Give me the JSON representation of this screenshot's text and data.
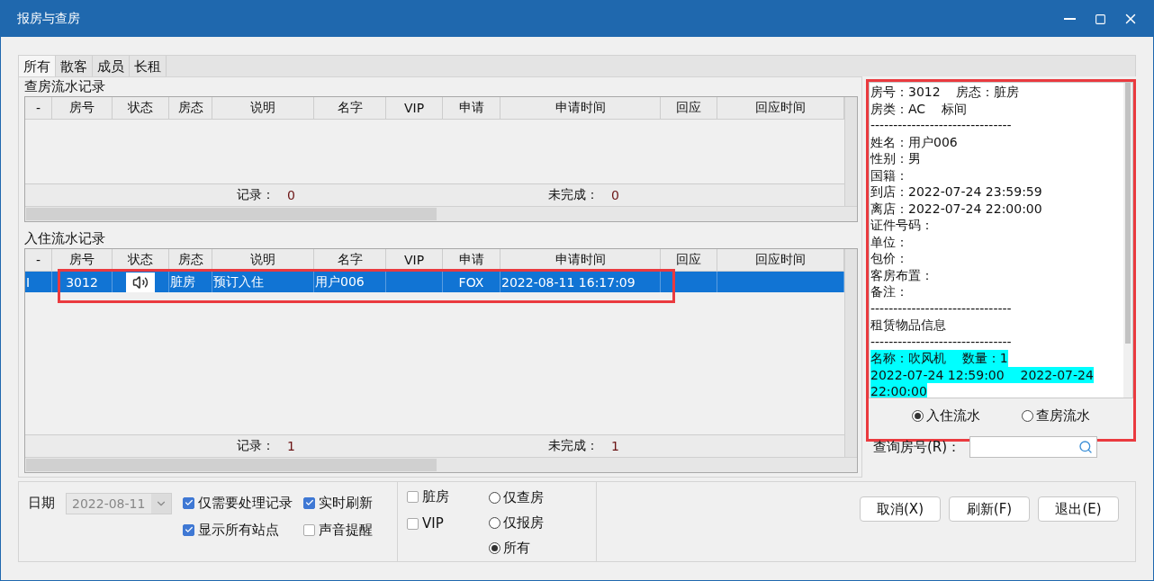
{
  "window": {
    "title": "报房与查房"
  },
  "tabs": [
    {
      "label": "所有",
      "selected": true
    },
    {
      "label": "散客",
      "selected": false
    },
    {
      "label": "成员",
      "selected": false
    },
    {
      "label": "长租",
      "selected": false
    }
  ],
  "check_log": {
    "title": "查房流水记录",
    "columns": [
      "-",
      "房号",
      "状态",
      "房态",
      "说明",
      "名字",
      "VIP",
      "申请",
      "申请时间",
      "回应",
      "回应时间"
    ],
    "records_label": "记录：",
    "records": "0",
    "pending_label": "未完成：",
    "pending": "0"
  },
  "checkin_log": {
    "title": "入住流水记录",
    "columns": [
      "-",
      "房号",
      "状态",
      "房态",
      "说明",
      "名字",
      "VIP",
      "申请",
      "申请时间",
      "回应",
      "回应时间"
    ],
    "rows": [
      {
        "selected": true,
        "marker": "I",
        "room_no": "3012",
        "room_state": "脏房",
        "note": "预订入住",
        "name": "用户006",
        "request": "FOX",
        "request_time": "2022-08-11 16:17:09"
      }
    ],
    "records_label": "记录：",
    "records": "1",
    "pending_label": "未完成：",
    "pending": "1"
  },
  "info_panel": {
    "lines": [
      {
        "text": "房号：3012    房态：脏房",
        "highlighted": false
      },
      {
        "text": "房类：AC    标间",
        "highlighted": false
      },
      {
        "text": "-------------------------------",
        "highlighted": false
      },
      {
        "text": "姓名：用户006",
        "highlighted": false
      },
      {
        "text": "性别：男",
        "highlighted": false
      },
      {
        "text": "国籍：",
        "highlighted": false
      },
      {
        "text": "到店：2022-07-24 23:59:59",
        "highlighted": false
      },
      {
        "text": "离店：2022-07-24 22:00:00",
        "highlighted": false
      },
      {
        "text": "证件号码：",
        "highlighted": false
      },
      {
        "text": "单位：",
        "highlighted": false
      },
      {
        "text": "包价：",
        "highlighted": false
      },
      {
        "text": "客房布置：",
        "highlighted": false
      },
      {
        "text": "备注：",
        "highlighted": false
      },
      {
        "text": "-------------------------------",
        "highlighted": false
      },
      {
        "text": "租赁物品信息",
        "highlighted": false
      },
      {
        "text": "-------------------------------",
        "highlighted": false
      },
      {
        "text": "名称：吹风机    数量：1",
        "highlighted": true
      },
      {
        "text": "2022-07-24 12:59:00    2022-07-24",
        "highlighted": true
      },
      {
        "text": "22:00:00",
        "highlighted": true
      }
    ],
    "modes": [
      {
        "label": "入住流水",
        "selected": true
      },
      {
        "label": "查房流水",
        "selected": false
      }
    ],
    "query_label": "查询房号(R)："
  },
  "filters": {
    "date_label": "日期",
    "date": "2022-08-11",
    "date_disabled": true,
    "options": [
      {
        "label": "仅需要处理记录",
        "checked": true
      },
      {
        "label": "实时刷新",
        "checked": true
      },
      {
        "label": "显示所有站点",
        "checked": true
      },
      {
        "label": "声音提醒",
        "checked": false
      }
    ],
    "room_flags": [
      {
        "label": "脏房",
        "checked": false
      },
      {
        "label": "VIP",
        "checked": false
      }
    ],
    "scope": [
      {
        "label": "仅查房",
        "selected": false
      },
      {
        "label": "仅报房",
        "selected": false
      },
      {
        "label": "所有",
        "selected": true
      }
    ]
  },
  "buttons": [
    "取消(X)",
    "刷新(F)",
    "退出(E)"
  ]
}
